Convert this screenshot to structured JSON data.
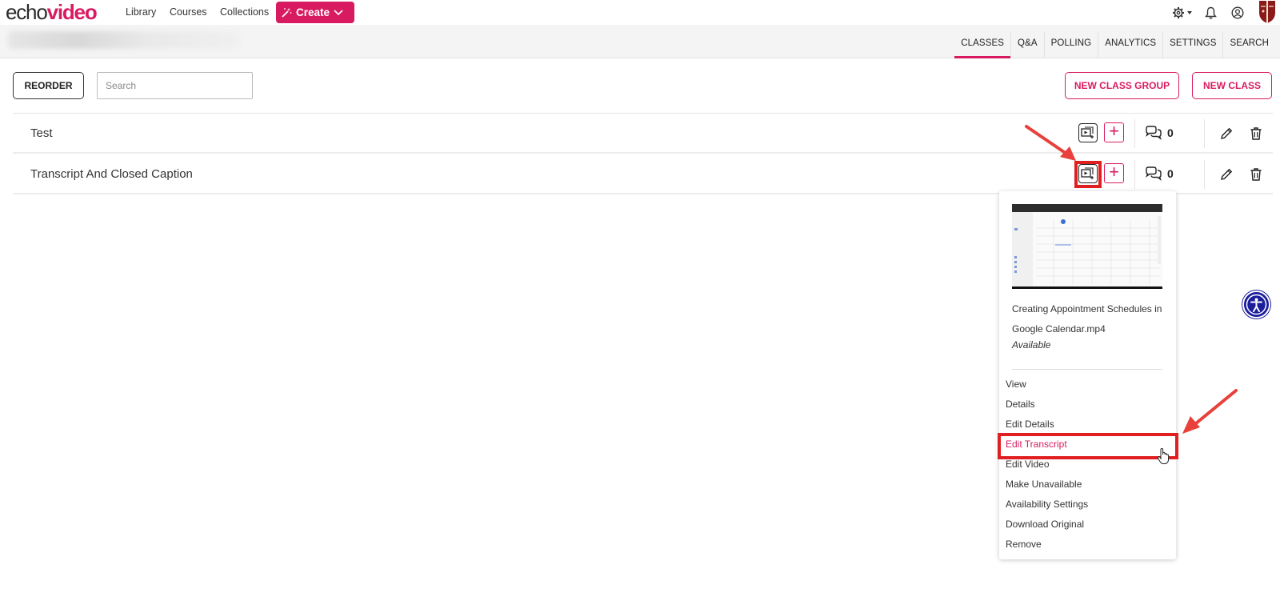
{
  "brand": {
    "logo_part1": "echo",
    "logo_part2": "video",
    "accent": "#d81b60"
  },
  "nav": {
    "links": [
      "Library",
      "Courses",
      "Collections"
    ],
    "create_label": "Create"
  },
  "tabs": [
    "CLASSES",
    "Q&A",
    "POLLING",
    "ANALYTICS",
    "SETTINGS",
    "SEARCH"
  ],
  "active_tab": "CLASSES",
  "toolbar": {
    "reorder_label": "REORDER",
    "search_placeholder": "Search",
    "new_group_label": "NEW CLASS GROUP",
    "new_class_label": "NEW CLASS"
  },
  "classes": [
    {
      "title": "Test",
      "qa_count": "0"
    },
    {
      "title": "Transcript And Closed Caption",
      "qa_count": "0"
    }
  ],
  "media_menu": {
    "name_line1": "Creating Appointment Schedules in",
    "name_line2": "Google Calendar.mp4",
    "status": "Available",
    "items": [
      "View",
      "Details",
      "Edit Details",
      "Edit Transcript",
      "Edit Video",
      "Make Unavailable",
      "Availability Settings",
      "Download Original",
      "Remove"
    ],
    "highlighted_item": "Edit Transcript"
  },
  "annotation_color": "#e02020",
  "icons": [
    "settings-icon",
    "bell-icon",
    "user-icon",
    "university-shield-icon",
    "media-icon",
    "plus-icon",
    "chat-icon",
    "pencil-icon",
    "trash-icon",
    "accessibility-icon",
    "hand-cursor-icon"
  ]
}
